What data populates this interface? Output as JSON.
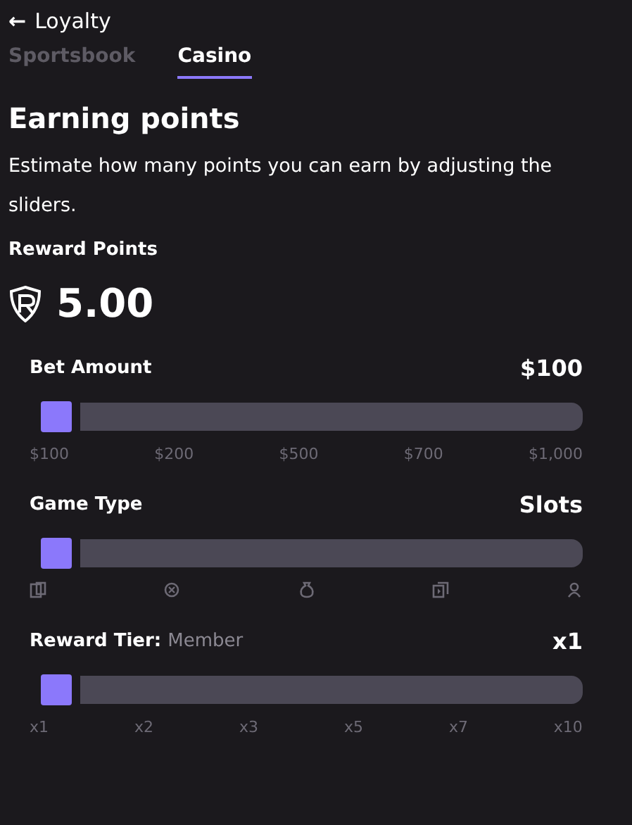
{
  "header": {
    "back": "←",
    "title": "Loyalty"
  },
  "tabs": [
    {
      "label": "Sportsbook",
      "selected": false
    },
    {
      "label": "Casino",
      "selected": true
    }
  ],
  "heading": "Earning points",
  "description": "Estimate how many points you can earn by adjusting the sliders.",
  "reward_points": {
    "label": "Reward Points",
    "value": "5.00"
  },
  "sliders": [
    {
      "label": "Bet Amount",
      "value": "$100",
      "level": 0,
      "kind": "labels",
      "ticks": [
        "$100",
        "$200",
        "$500",
        "$700",
        "$1,000"
      ]
    },
    {
      "label": "Game Type",
      "value": "Slots",
      "level": 0,
      "kind": "icons"
    },
    {
      "label": "Reward Tier:",
      "sublabel": "Member",
      "value": "x1",
      "level": 0,
      "kind": "labels",
      "ticks": [
        "x1",
        "x2",
        "x3",
        "x5",
        "x7",
        "x10"
      ]
    }
  ]
}
